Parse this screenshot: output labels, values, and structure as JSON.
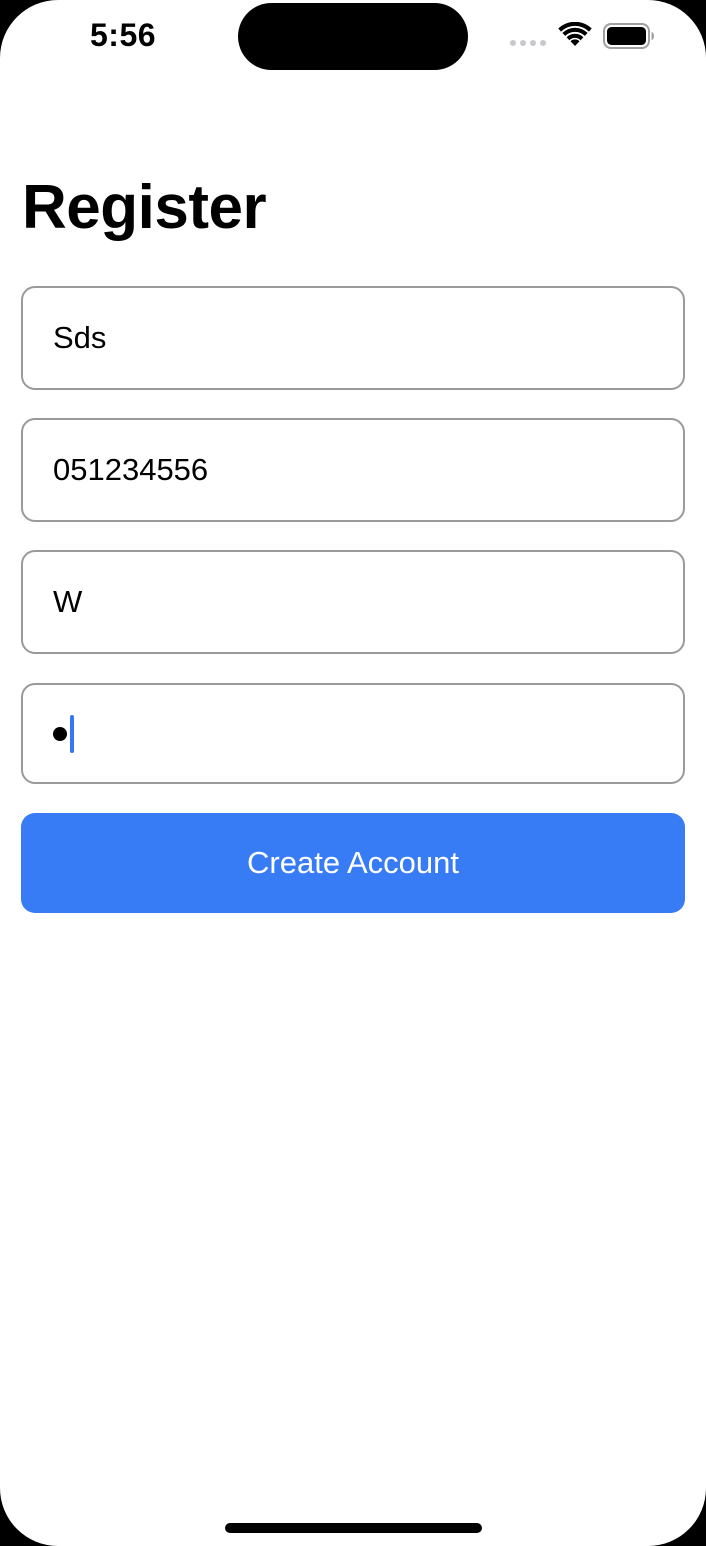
{
  "status_bar": {
    "time": "5:56",
    "icons": [
      "cellular-signal-icon",
      "wifi-icon",
      "battery-icon"
    ]
  },
  "title": "Register",
  "fields": [
    {
      "value": "Sds"
    },
    {
      "value": "051234556"
    },
    {
      "value": "W"
    },
    {
      "type": "password",
      "masked_length": 1,
      "focused": true
    }
  ],
  "create_button": {
    "label": "Create Account",
    "color": "#377cf5"
  },
  "colors": {
    "accent": "#377cf5",
    "field_border": "#9a9a9a",
    "caret": "#3478f6"
  }
}
